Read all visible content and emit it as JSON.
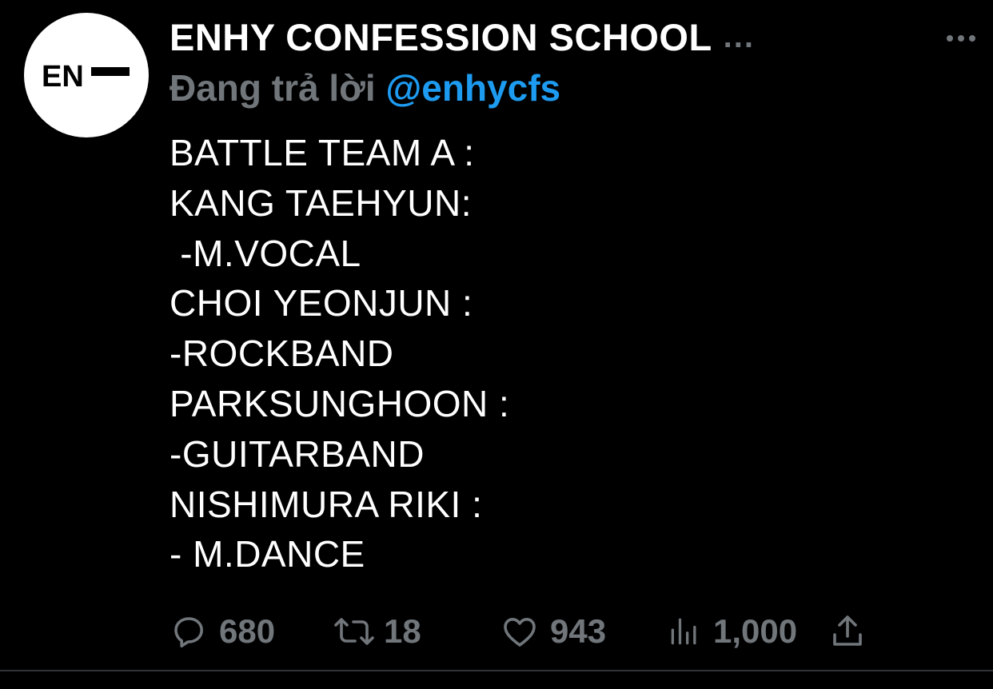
{
  "author": {
    "display_name": "ENHY CONFESSION SCHOOL",
    "name_ellipsis": "...",
    "avatar_text": "EN"
  },
  "reply": {
    "prefix": "Đang trả lời ",
    "handle": "@enhycfs"
  },
  "tweet_lines": [
    "BATTLE TEAM A :",
    "KANG TAEHYUN:",
    " -M.VOCAL",
    "CHOI YEONJUN :",
    "-ROCKBAND",
    "PARKSUNGHOON :",
    "-GUITARBAND",
    "NISHIMURA RIKI :",
    "- M.DANCE"
  ],
  "actions": {
    "replies": "680",
    "retweets": "18",
    "likes": "943",
    "views": "1,000"
  },
  "colors": {
    "background": "#000000",
    "text_primary": "#ffffff",
    "text_secondary": "#71767b",
    "accent": "#1d9bf0"
  },
  "icons": {
    "more": "more-horizontal-icon",
    "reply": "reply-bubble-icon",
    "retweet": "retweet-icon",
    "like": "heart-icon",
    "views": "analytics-bars-icon",
    "share": "share-upload-icon"
  }
}
